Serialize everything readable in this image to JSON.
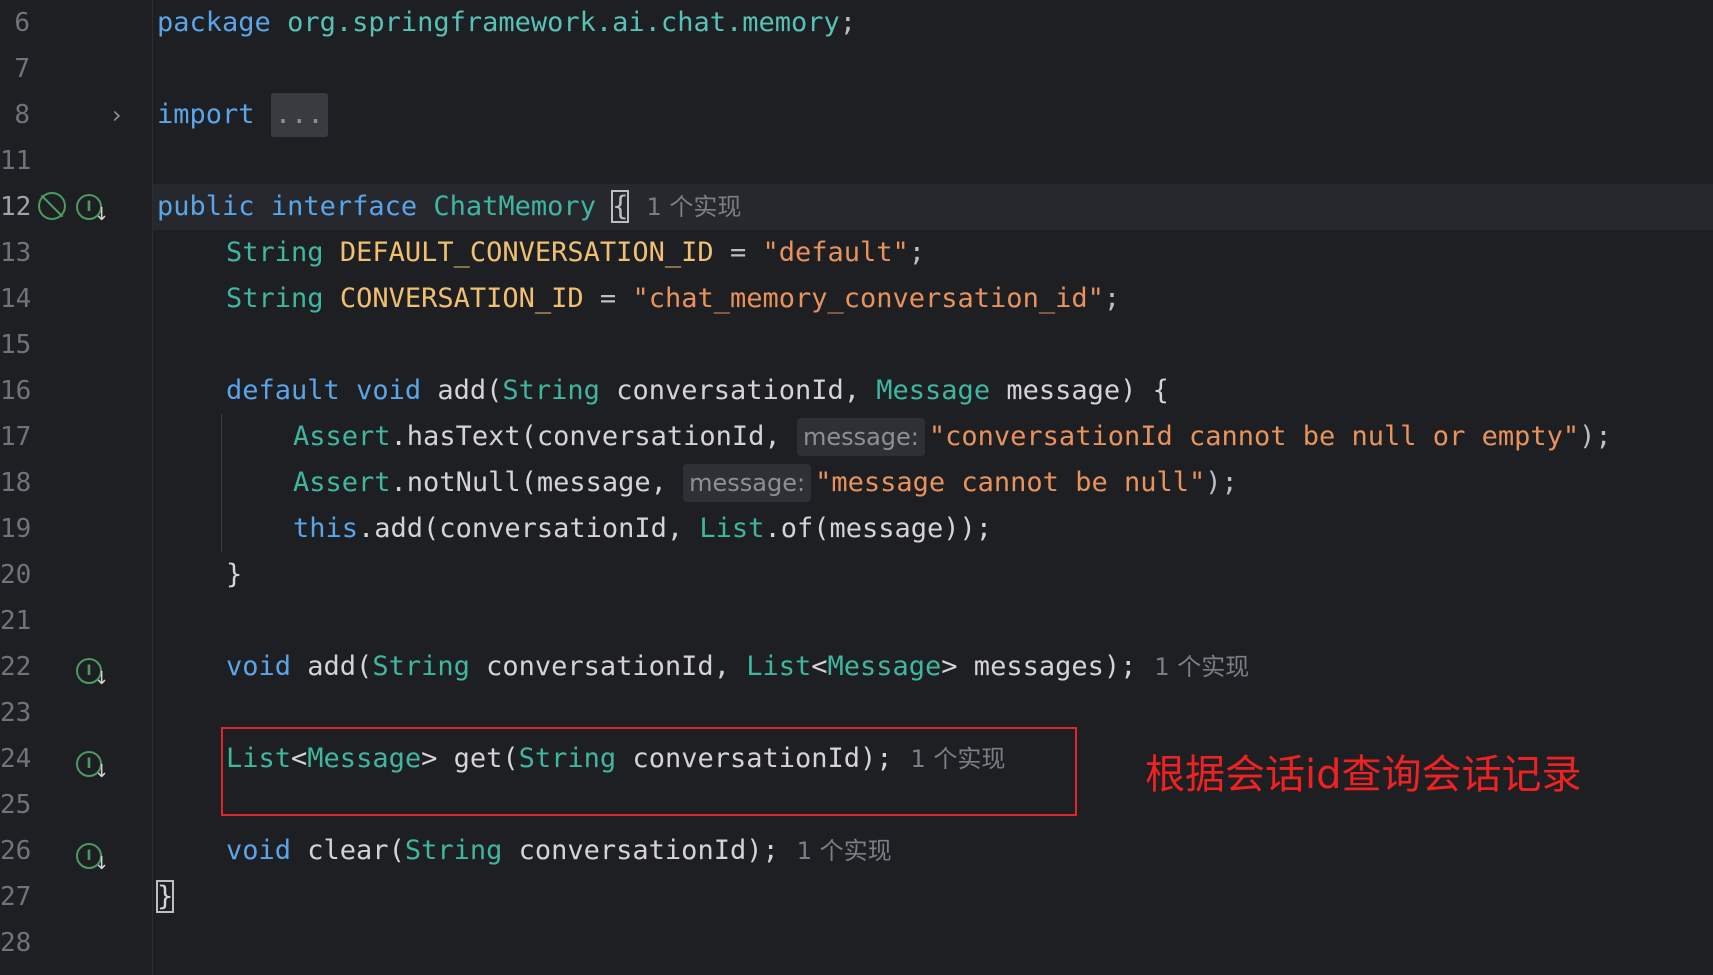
{
  "gutter": {
    "line_numbers": [
      "6",
      "7",
      "8",
      "11",
      "12",
      "13",
      "14",
      "15",
      "16",
      "17",
      "18",
      "19",
      "20",
      "21",
      "22",
      "23",
      "24",
      "25",
      "26",
      "27",
      "28"
    ]
  },
  "code": {
    "line6": {
      "kw": "package",
      "pkg": "org.springframework.ai.chat.memory",
      "end": ";"
    },
    "line8": {
      "kw": "import",
      "fold": "..."
    },
    "line12": {
      "kw1": "public",
      "kw2": "interface",
      "type": "ChatMemory",
      "brace": "{",
      "impl": "1 个实现"
    },
    "line13": {
      "type": "String",
      "const": "DEFAULT_CONVERSATION_ID",
      "op": " = ",
      "str": "\"default\"",
      "end": ";"
    },
    "line14": {
      "type": "String",
      "const": "CONVERSATION_ID",
      "op": " = ",
      "str": "\"chat_memory_conversation_id\"",
      "end": ";"
    },
    "line16": {
      "kw1": "default",
      "kw2": "void",
      "name": "add(",
      "t1": "String",
      "p1": " conversationId, ",
      "t2": "Message",
      "p2": " message) {"
    },
    "line17": {
      "cls": "Assert",
      "call": ".hasText(conversationId, ",
      "hint": "message:",
      "str": "\"conversationId cannot be null or empty\"",
      "end": ");"
    },
    "line18": {
      "cls": "Assert",
      "call": ".notNull(message, ",
      "hint": "message:",
      "str": "\"message cannot be null\"",
      "end": ");"
    },
    "line19": {
      "kw": "this",
      "call1": ".add(conversationId, ",
      "cls": "List",
      "call2": ".of(message));"
    },
    "line20": {
      "text": "}"
    },
    "line22": {
      "kw": "void",
      "name": " add(",
      "t1": "String",
      "p1": " conversationId, ",
      "t2": "List",
      "lt": "<",
      "t3": "Message",
      "rest": "> messages);",
      "impl": "1 个实现"
    },
    "line24": {
      "t1": "List",
      "lt": "<",
      "t2": "Message",
      "gt": "> get(",
      "t3": "String",
      "rest": " conversationId);",
      "impl": "1 个实现"
    },
    "line26": {
      "kw": "void",
      "name": " clear(",
      "t1": "String",
      "rest": " conversationId);",
      "impl": "1 个实现"
    },
    "line27": {
      "text": "}"
    }
  },
  "annotation": {
    "text": "根据会话id查询会话记录"
  }
}
